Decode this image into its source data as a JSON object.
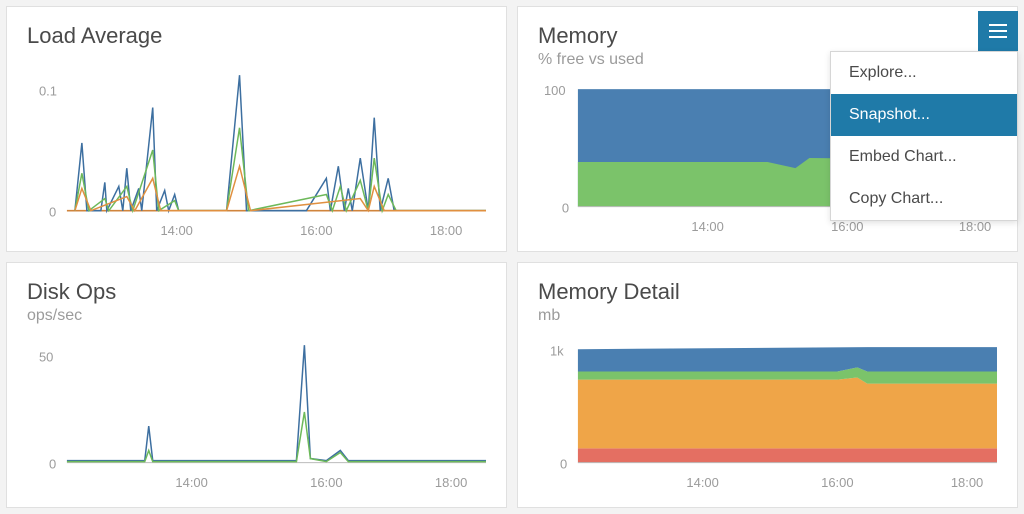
{
  "panels": {
    "loadAvg": {
      "title": "Load Average",
      "sub": ""
    },
    "memory": {
      "title": "Memory",
      "sub": "% free vs used"
    },
    "diskOps": {
      "title": "Disk Ops",
      "sub": "ops/sec"
    },
    "memDetail": {
      "title": "Memory Detail",
      "sub": "mb"
    }
  },
  "menu": {
    "items": [
      "Explore...",
      "Snapshot...",
      "Embed Chart...",
      "Copy Chart..."
    ],
    "selectedIndex": 1
  },
  "axes": {
    "xTicks": [
      "14:00",
      "16:00",
      "18:00"
    ],
    "loadAvg_y": [
      "0",
      "0.1"
    ],
    "memory_y": [
      "0",
      "100"
    ],
    "diskOps_y": [
      "0",
      "50"
    ],
    "memDetail_y": [
      "0",
      "1k"
    ]
  },
  "chart_data": [
    {
      "type": "line",
      "title": "Load Average",
      "xlabel": "",
      "ylabel": "",
      "ylim": [
        0,
        0.12
      ],
      "x_axis_ticks": [
        "14:00",
        "16:00",
        "18:00"
      ],
      "y_axis_ticks": [
        0,
        0.1
      ],
      "series": [
        {
          "name": "series-blue",
          "x": [
            "12:50",
            "13:00",
            "13:05",
            "13:10",
            "13:20",
            "13:30",
            "13:40",
            "13:50",
            "14:00",
            "14:10",
            "14:40",
            "14:50",
            "15:30",
            "15:40",
            "15:50",
            "16:00",
            "16:10",
            "16:20",
            "16:30",
            "16:40",
            "18:00"
          ],
          "values": [
            0.05,
            0,
            0.02,
            0.04,
            0.04,
            0.1,
            0.02,
            0.02,
            0,
            0,
            0.13,
            0,
            0,
            0.04,
            0.05,
            0.03,
            0.05,
            0.09,
            0.03,
            0,
            0
          ]
        },
        {
          "name": "series-green",
          "x": [
            "12:50",
            "13:00",
            "13:05",
            "13:10",
            "13:20",
            "13:30",
            "13:40",
            "13:50",
            "14:00",
            "14:10",
            "14:40",
            "14:50",
            "15:30",
            "15:40",
            "15:50",
            "16:00",
            "16:10",
            "16:20",
            "16:30",
            "16:40",
            "18:00"
          ],
          "values": [
            0.03,
            0,
            0.015,
            0.02,
            0.02,
            0.06,
            0.015,
            0.015,
            0,
            0,
            0.08,
            0,
            0,
            0.025,
            0.035,
            0.02,
            0.035,
            0.06,
            0.02,
            0,
            0
          ]
        },
        {
          "name": "series-orange",
          "x": [
            "12:50",
            "13:00",
            "13:05",
            "13:10",
            "13:20",
            "13:30",
            "13:40",
            "13:50",
            "14:00",
            "14:10",
            "14:40",
            "14:50",
            "15:30",
            "15:40",
            "15:50",
            "16:00",
            "16:10",
            "16:20",
            "16:30",
            "16:40",
            "18:00"
          ],
          "values": [
            0.02,
            0,
            0.01,
            0.012,
            0.012,
            0.03,
            0.01,
            0.01,
            0,
            0,
            0.04,
            0,
            0,
            0.01,
            0.015,
            0.01,
            0.015,
            0.03,
            0.01,
            0,
            0
          ]
        }
      ]
    },
    {
      "type": "area",
      "title": "Memory",
      "subtitle": "% free vs used",
      "stacked": true,
      "xlabel": "",
      "ylabel": "",
      "ylim": [
        0,
        100
      ],
      "x_axis_ticks": [
        "14:00",
        "16:00",
        "18:00"
      ],
      "y_axis_ticks": [
        0,
        100
      ],
      "series": [
        {
          "name": "used-green",
          "x": [
            "12:40",
            "14:00",
            "16:00",
            "16:30",
            "18:00"
          ],
          "values": [
            38,
            38,
            35,
            38,
            38
          ]
        },
        {
          "name": "free-blue",
          "x": [
            "12:40",
            "14:00",
            "16:00",
            "16:30",
            "18:00"
          ],
          "values": [
            62,
            62,
            65,
            62,
            62
          ]
        }
      ]
    },
    {
      "type": "line",
      "title": "Disk Ops",
      "subtitle": "ops/sec",
      "xlabel": "",
      "ylabel": "",
      "ylim": [
        0,
        55
      ],
      "x_axis_ticks": [
        "14:00",
        "16:00",
        "18:00"
      ],
      "y_axis_ticks": [
        0,
        50
      ],
      "series": [
        {
          "name": "series-blue",
          "x": [
            "12:40",
            "13:30",
            "13:32",
            "13:34",
            "15:00",
            "15:50",
            "15:52",
            "15:54",
            "16:10",
            "16:20",
            "18:00"
          ],
          "values": [
            2,
            2,
            16,
            2,
            2,
            2,
            50,
            4,
            6,
            2,
            2
          ]
        },
        {
          "name": "series-green",
          "x": [
            "12:40",
            "13:30",
            "13:32",
            "13:34",
            "15:00",
            "15:50",
            "15:52",
            "15:54",
            "16:10",
            "16:20",
            "18:00"
          ],
          "values": [
            1,
            1,
            5,
            1,
            1,
            1,
            20,
            3,
            5,
            1,
            1
          ]
        }
      ]
    },
    {
      "type": "area",
      "title": "Memory Detail",
      "subtitle": "mb",
      "stacked": true,
      "xlabel": "",
      "ylabel": "",
      "ylim": [
        0,
        1050
      ],
      "x_axis_ticks": [
        "14:00",
        "16:00",
        "18:00"
      ],
      "y_axis_ticks": [
        0,
        1000
      ],
      "series": [
        {
          "name": "red",
          "x": [
            "12:40",
            "14:00",
            "16:00",
            "16:10",
            "18:00"
          ],
          "values": [
            110,
            110,
            110,
            110,
            110
          ]
        },
        {
          "name": "orange",
          "x": [
            "12:40",
            "14:00",
            "16:00",
            "16:10",
            "18:00"
          ],
          "values": [
            620,
            620,
            620,
            580,
            580
          ]
        },
        {
          "name": "green",
          "x": [
            "12:40",
            "14:00",
            "16:00",
            "16:10",
            "18:00"
          ],
          "values": [
            70,
            70,
            70,
            100,
            100
          ]
        },
        {
          "name": "blue",
          "x": [
            "12:40",
            "14:00",
            "16:00",
            "16:10",
            "18:00"
          ],
          "values": [
            220,
            220,
            220,
            230,
            230
          ]
        }
      ]
    }
  ]
}
